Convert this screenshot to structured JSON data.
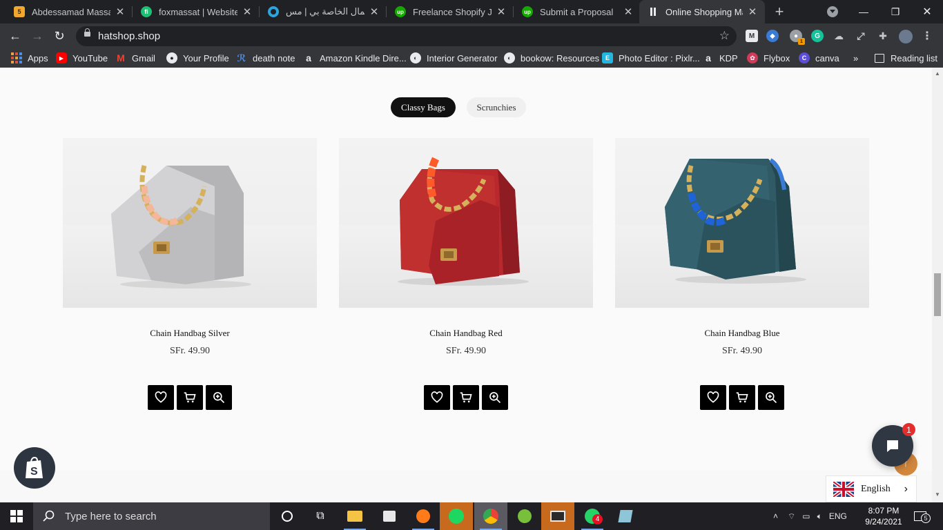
{
  "browser": {
    "tabs": [
      {
        "title": "Abdessamad Massat -",
        "favicon": "orange-5"
      },
      {
        "title": "foxmassat | Website C",
        "favicon": "fiverr"
      },
      {
        "title": "الأعمال الخاصة بي | مس",
        "favicon": "mostaql"
      },
      {
        "title": "Freelance Shopify Jobs",
        "favicon": "upwork"
      },
      {
        "title": "Submit a Proposal",
        "favicon": "upwork"
      },
      {
        "title": "Online Shopping Mad",
        "favicon": "hatshop",
        "active": true
      }
    ],
    "url": "hatshop.shop",
    "bookmarks": [
      {
        "label": "Apps"
      },
      {
        "label": "YouTube"
      },
      {
        "label": "Gmail"
      },
      {
        "label": "Your Profile"
      },
      {
        "label": "death note"
      },
      {
        "label": "Amazon Kindle Dire..."
      },
      {
        "label": "Interior Generator"
      },
      {
        "label": "bookow: Resources"
      },
      {
        "label": "Photo Editor : Pixlr..."
      },
      {
        "label": "KDP"
      },
      {
        "label": "Flybox"
      },
      {
        "label": "canva"
      }
    ],
    "overflow_label": "»",
    "reading_list": "Reading list",
    "ext_badge": "1"
  },
  "page": {
    "filters": [
      {
        "label": "Classy Bags",
        "active": true
      },
      {
        "label": "Scrunchies",
        "active": false
      }
    ],
    "products": [
      {
        "name": "Chain Handbag Silver",
        "price": "SFr. 49.90",
        "bag_color": "#c9c9cb",
        "chain_accent": "#f4b79a"
      },
      {
        "name": "Chain Handbag Red",
        "price": "SFr. 49.90",
        "bag_color": "#b8282c",
        "chain_accent": "#ff5a2a"
      },
      {
        "name": "Chain Handbag Blue",
        "price": "SFr. 49.90",
        "bag_color": "#2f5a66",
        "chain_accent": "#1e63d8"
      }
    ],
    "chat_badge": "1",
    "language": "English"
  },
  "taskbar": {
    "search_placeholder": "Type here to search",
    "time": "8:07 PM",
    "date": "9/24/2021",
    "lang": "ENG",
    "whatsapp_badge": "4",
    "notification_count": "5"
  }
}
